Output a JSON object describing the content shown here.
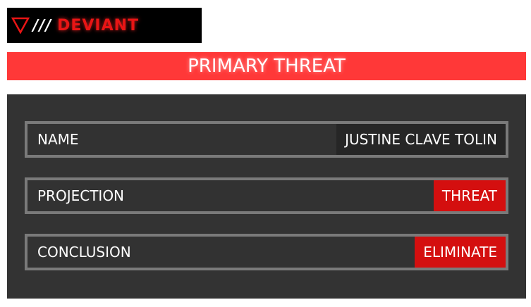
{
  "brand": {
    "slashes": "///",
    "name": "DEVIANT",
    "icon": "triangle-down-icon",
    "accent_color": "#e81515"
  },
  "banner": {
    "title": "PRIMARY THREAT",
    "color": "#ff3838"
  },
  "fields": [
    {
      "label": "NAME",
      "value": "JUSTINE CLAVE TOLIN",
      "value_style": "dark"
    },
    {
      "label": "PROJECTION",
      "value": "THREAT",
      "value_style": "red"
    },
    {
      "label": "CONCLUSION",
      "value": "ELIMINATE",
      "value_style": "red"
    }
  ],
  "colors": {
    "panel": "#333333",
    "row_border": "#7a7a7a",
    "value_red": "#d40f0f",
    "value_dark": "#262626"
  }
}
